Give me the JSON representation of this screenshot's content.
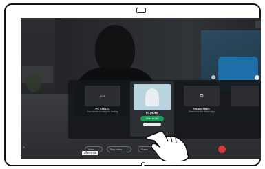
{
  "share_panel": {
    "items": [
      {
        "title": "PC (USB-C)",
        "subtitle": "Your screen is ready for sharing",
        "icon": "monitor-icon"
      },
      {
        "title": "PC (HDMI)",
        "button_label": "Share in Call",
        "secondary_button_label": "",
        "icon": "camera-preview"
      },
      {
        "title": "Webex Share",
        "subtitle": "Share from the Webex app",
        "icon": "share-screen-icon"
      },
      {
        "title": "",
        "subtitle": ""
      }
    ],
    "tooltip": "Share in Call"
  },
  "call_controls": {
    "mute_label": "Mute",
    "video_label": "Stop video",
    "share_label": "Share"
  },
  "colors": {
    "accent_green": "#1e9e5b",
    "end_call_red": "#d63a3a",
    "chair_blue": "#1d6fa8"
  }
}
